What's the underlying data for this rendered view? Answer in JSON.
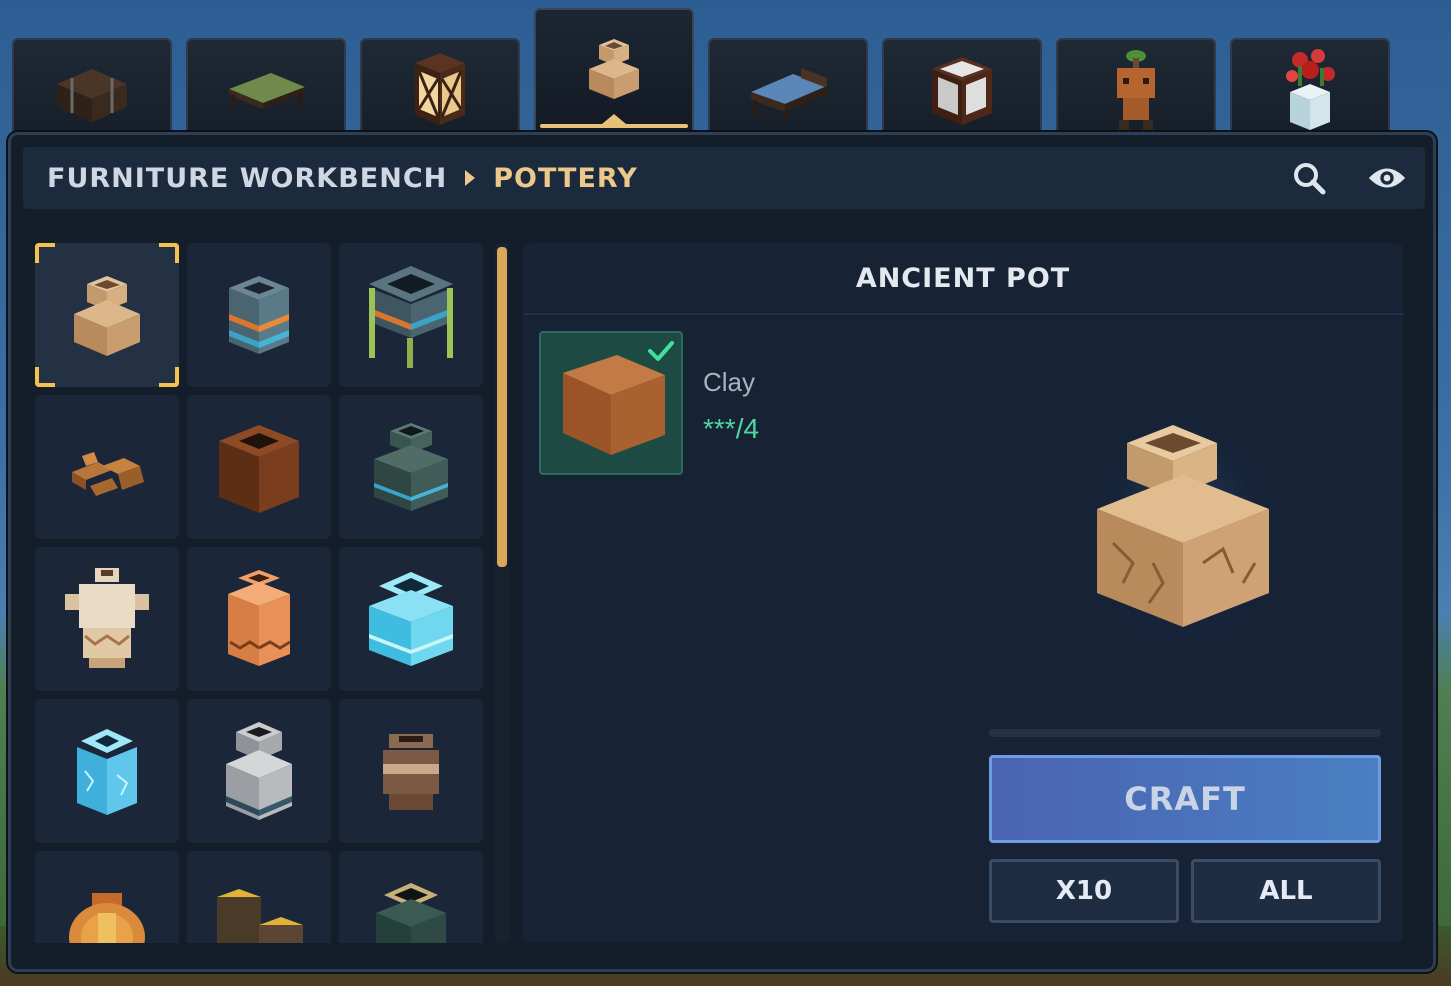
{
  "tabs": [
    {
      "icon": "chest-icon"
    },
    {
      "icon": "bed-icon"
    },
    {
      "icon": "lantern-icon"
    },
    {
      "icon": "pot-icon",
      "active": true
    },
    {
      "icon": "blue-bed-icon"
    },
    {
      "icon": "lamp-block-icon"
    },
    {
      "icon": "plant-creature-icon"
    },
    {
      "icon": "flower-pot-icon"
    }
  ],
  "header": {
    "root": "FURNITURE WORKBENCH",
    "current": "POTTERY"
  },
  "grid": {
    "items": [
      {
        "name": "ancient-pot",
        "color": "#c79a6b",
        "selected": true
      },
      {
        "name": "teal-striped-pot",
        "color": "#5a7a88"
      },
      {
        "name": "bamboo-pot-table",
        "color": "#48606c"
      },
      {
        "name": "broken-pot",
        "color": "#a5682f"
      },
      {
        "name": "brown-pot",
        "color": "#7a3e1f"
      },
      {
        "name": "dark-teal-pot",
        "color": "#3f5c58"
      },
      {
        "name": "cream-amphora",
        "color": "#e6d1b2"
      },
      {
        "name": "terracotta-pot",
        "color": "#e38f57"
      },
      {
        "name": "ice-pot",
        "color": "#6fd8f0"
      },
      {
        "name": "ice-vase",
        "color": "#5fc7ec"
      },
      {
        "name": "stone-pot",
        "color": "#a7a9ad"
      },
      {
        "name": "clay-jar",
        "color": "#7a5a45"
      },
      {
        "name": "golden-urn",
        "color": "#d98a3a"
      },
      {
        "name": "wooden-stumps",
        "color": "#5a4632"
      },
      {
        "name": "green-glow-pot",
        "color": "#2f4a44"
      }
    ]
  },
  "detail": {
    "title": "ANCIENT POT",
    "ingredient": {
      "name": "Clay",
      "count": "***/4",
      "color": "#a8612f"
    },
    "buttons": {
      "craft": "CRAFT",
      "x10": "X10",
      "all": "ALL"
    }
  }
}
